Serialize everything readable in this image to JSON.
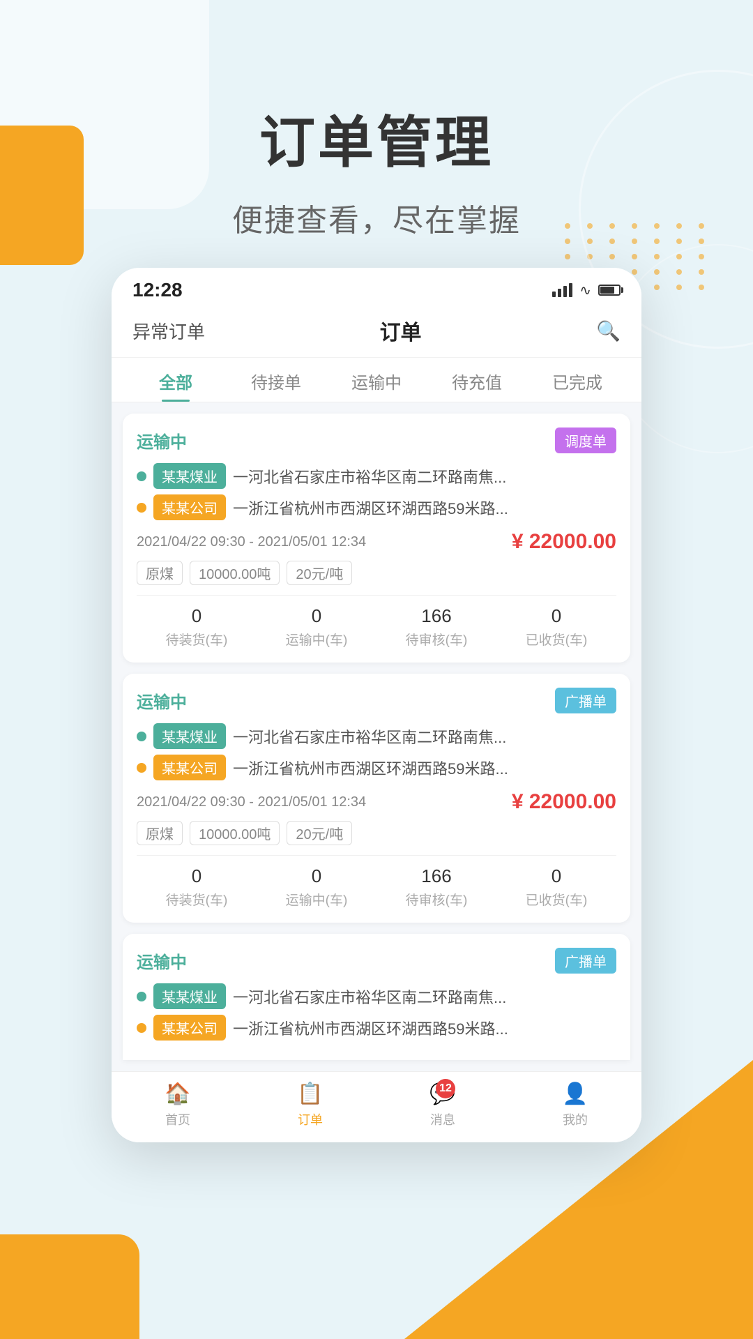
{
  "page": {
    "background_color": "#e8f4f8",
    "title": "订单管理",
    "subtitle": "便捷查看，尽在掌握"
  },
  "status_bar": {
    "time": "12:28",
    "signal_label": "signal",
    "wifi_label": "wifi",
    "battery_label": "battery"
  },
  "nav": {
    "abnormal_orders": "异常订单",
    "title": "订单",
    "search_label": "搜索"
  },
  "tabs": [
    {
      "id": "all",
      "label": "全部",
      "active": true
    },
    {
      "id": "waiting",
      "label": "待接单",
      "active": false
    },
    {
      "id": "shipping",
      "label": "运输中",
      "active": false
    },
    {
      "id": "recharge",
      "label": "待充值",
      "active": false
    },
    {
      "id": "done",
      "label": "已完成",
      "active": false
    }
  ],
  "orders": [
    {
      "id": "order1",
      "status": "运输中",
      "badge_type": "调度单",
      "badge_class": "dispatch",
      "from_company": "某某煤业",
      "from_company_color": "green",
      "from_route": "一河北省石家庄市裕华区南二环路南焦...",
      "to_company": "某某公司",
      "to_company_color": "orange",
      "to_route": "一浙江省杭州市西湖区环湖西路59米路...",
      "date_range": "2021/04/22 09:30 - 2021/05/01 12:34",
      "price": "¥ 22000.00",
      "tags": [
        "原煤",
        "10000.00吨",
        "20元/吨"
      ],
      "stats": [
        {
          "value": "0",
          "label": "待装货(车)"
        },
        {
          "value": "0",
          "label": "运输中(车)"
        },
        {
          "value": "166",
          "label": "待审核(车)"
        },
        {
          "value": "0",
          "label": "已收货(车)"
        }
      ]
    },
    {
      "id": "order2",
      "status": "运输中",
      "badge_type": "广播单",
      "badge_class": "broadcast",
      "from_company": "某某煤业",
      "from_company_color": "green",
      "from_route": "一河北省石家庄市裕华区南二环路南焦...",
      "to_company": "某某公司",
      "to_company_color": "orange",
      "to_route": "一浙江省杭州市西湖区环湖西路59米路...",
      "date_range": "2021/04/22 09:30 - 2021/05/01 12:34",
      "price": "¥ 22000.00",
      "tags": [
        "原煤",
        "10000.00吨",
        "20元/吨"
      ],
      "stats": [
        {
          "value": "0",
          "label": "待装货(车)"
        },
        {
          "value": "0",
          "label": "运输中(车)"
        },
        {
          "value": "166",
          "label": "待审核(车)"
        },
        {
          "value": "0",
          "label": "已收货(车)"
        }
      ]
    },
    {
      "id": "order3",
      "status": "运输中",
      "badge_type": "广播单",
      "badge_class": "broadcast",
      "from_company": "某某煤业",
      "from_company_color": "green",
      "from_route": "一河北省石家庄市裕华区南二环路南焦...",
      "to_company": "某某公司",
      "to_company_color": "orange",
      "to_route": "一浙江省杭州市西湖区环湖西路59米路...",
      "partial": true
    }
  ],
  "bottom_nav": [
    {
      "id": "home",
      "label": "首页",
      "icon": "🏠",
      "active": false
    },
    {
      "id": "order",
      "label": "订单",
      "icon": "📋",
      "active": true
    },
    {
      "id": "message",
      "label": "消息",
      "icon": "💬",
      "active": false,
      "badge": "12"
    },
    {
      "id": "profile",
      "label": "我的",
      "icon": "👤",
      "active": false
    }
  ]
}
